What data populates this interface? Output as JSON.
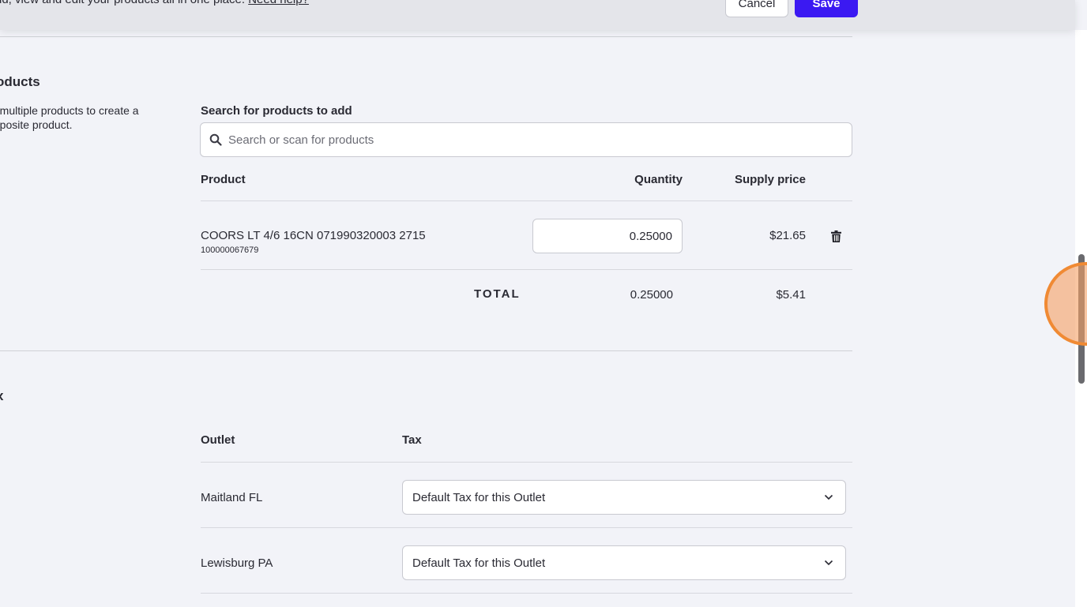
{
  "header": {
    "description": "dd, view and edit your products all in one place.",
    "help_link": "Need help?",
    "cancel_label": "Cancel",
    "save_label": "Save"
  },
  "products_section": {
    "title": "oducts",
    "description": "d multiple products to create a mposite product.",
    "search_label": "Search for products to add",
    "search_placeholder": "Search or scan for products",
    "columns": {
      "product": "Product",
      "quantity": "Quantity",
      "supply_price": "Supply price"
    },
    "items": [
      {
        "name": "COORS LT 4/6 16CN 071990320003 2715",
        "sku": "100000067679",
        "quantity": "0.25000",
        "supply_price": "$21.65"
      }
    ],
    "total": {
      "label": "TOTAL",
      "quantity": "0.25000",
      "price": "$5.41"
    }
  },
  "tax_section": {
    "title": "x",
    "columns": {
      "outlet": "Outlet",
      "tax": "Tax"
    },
    "rows": [
      {
        "outlet": "Maitland FL",
        "tax": "Default Tax for this Outlet"
      },
      {
        "outlet": "Lewisburg PA",
        "tax": "Default Tax for this Outlet"
      }
    ]
  },
  "colors": {
    "primary_button": "#3b19f2",
    "background": "#f2f3f8",
    "cursor_highlight": "#f08a34"
  },
  "icons": [
    "search-icon",
    "trash-icon",
    "chevron-down-icon"
  ]
}
